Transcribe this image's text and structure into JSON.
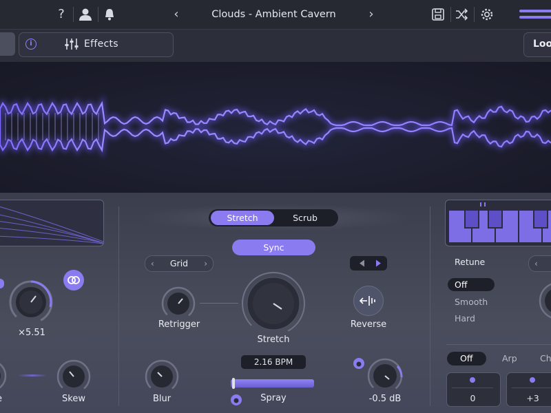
{
  "top_bar": {
    "help_icon": "question-icon",
    "account_icon": "user-icon",
    "notifications_icon": "bell-icon",
    "preset_name": "Clouds - Ambient Cavern",
    "prev_icon": "chevron-left-icon",
    "next_icon": "chevron-right-icon",
    "save_icon": "save-icon",
    "shuffle_icon": "shuffle-icon",
    "settings_icon": "gear-icon",
    "menu_icon": "hamburger-icon"
  },
  "toolbar": {
    "effects_label": "Effects",
    "loop_label": "Loo"
  },
  "granular": {
    "mode_tabs": [
      "Stretch",
      "Scrub"
    ],
    "active_mode": "Stretch",
    "sync_label": "Sync",
    "grid_label": "Grid",
    "retrigger_label": "Retrigger",
    "stretch_label": "Stretch",
    "reverse_label": "Reverse",
    "blur_label": "Blur",
    "rate_readout": "2.16 BPM",
    "spray_label": "Spray",
    "gain_readout": "-0.5 dB"
  },
  "left_panel": {
    "multiplier_readout": "×5.51",
    "partial_label": "e",
    "skew_label": "Skew"
  },
  "right_panel": {
    "retune_label": "Retune",
    "retune_options": [
      "Off",
      "Smooth",
      "Hard"
    ],
    "retune_selected": "Off",
    "voice_modes": [
      "Off",
      "Arp",
      "Ch"
    ],
    "voice_mode_selected": "Off",
    "voice_values": [
      "0",
      "+3"
    ]
  },
  "colors": {
    "accent": "#8a7cf0",
    "background": "#2b2e3a",
    "waveform_bg": "#1c1d2c"
  }
}
